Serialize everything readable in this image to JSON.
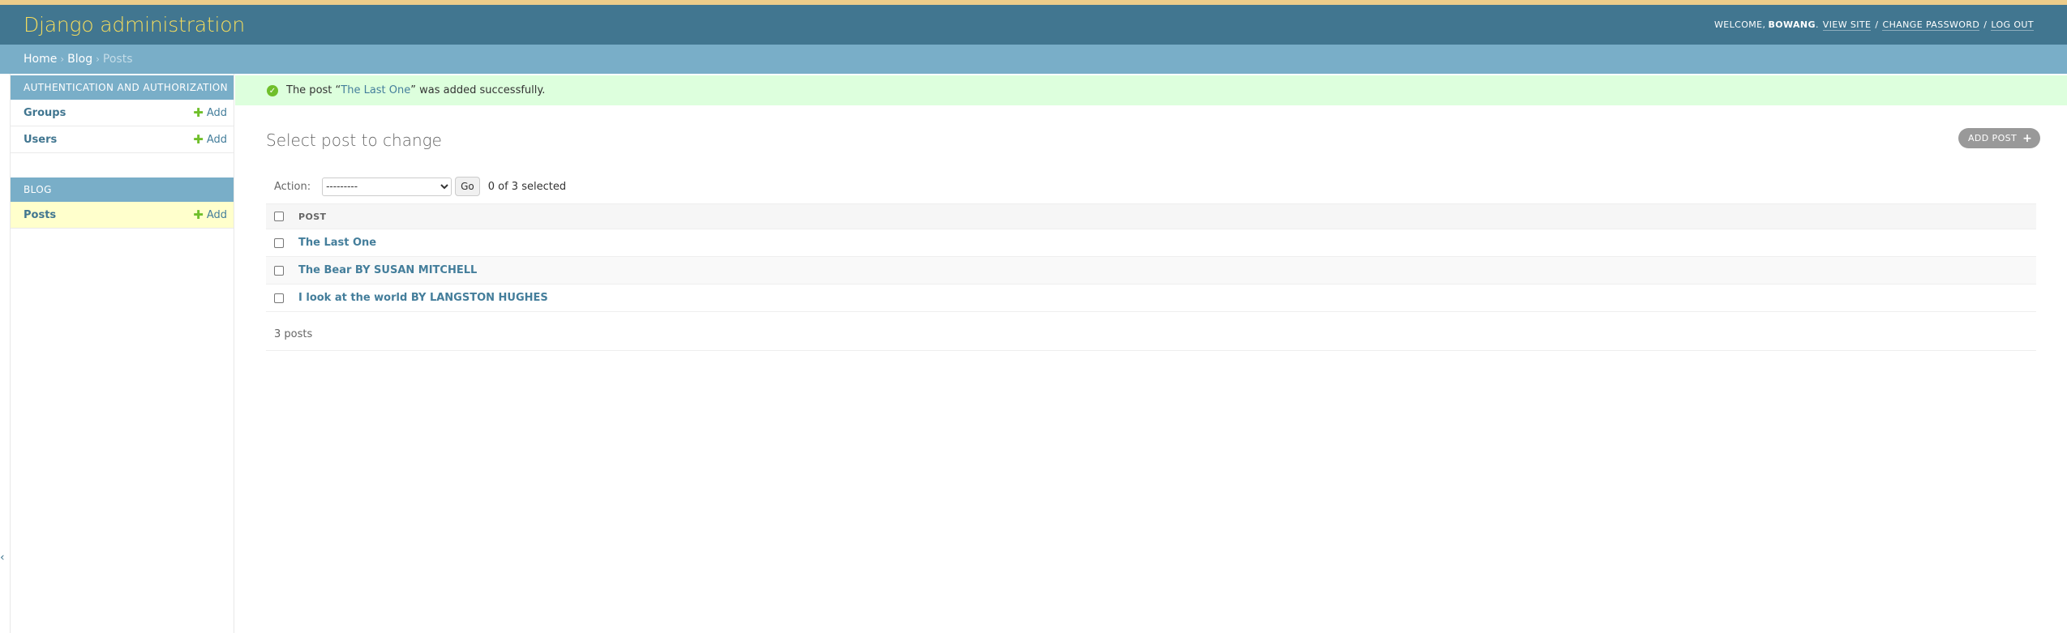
{
  "header": {
    "brand": "Django administration",
    "welcome": "Welcome,",
    "username": "bowang",
    "view_site": "View site",
    "change_password": "Change password",
    "log_out": "Log out",
    "sep": "/"
  },
  "breadcrumbs": {
    "home": "Home",
    "app": "Blog",
    "current": "Posts",
    "sep": "›"
  },
  "sidebar": {
    "modules": [
      {
        "caption": "Authentication and Authorization",
        "models": [
          {
            "name": "Groups",
            "add": "Add"
          },
          {
            "name": "Users",
            "add": "Add"
          }
        ]
      },
      {
        "caption": "Blog",
        "models": [
          {
            "name": "Posts",
            "add": "Add"
          }
        ]
      }
    ],
    "toggle": "‹"
  },
  "message": {
    "prefix": "The post “",
    "link": "The Last One",
    "suffix": "” was added successfully."
  },
  "main": {
    "title": "Select post to change",
    "add_button": "Add post",
    "add_icon": "+",
    "action_label": "Action:",
    "action_select": "---------",
    "go": "Go",
    "selected": "0 of 3 selected",
    "column_header": "Post",
    "rows": [
      "The Last One",
      "The Bear BY SUSAN MITCHELL",
      "I look at the world BY LANGSTON HUGHES"
    ],
    "count": "3 posts"
  },
  "colors": {
    "header": "#417690",
    "breadcrumbs": "#79aec8",
    "brand": "#f5dd5d",
    "success": "#dfd",
    "link": "#447e9b",
    "add": "#70bf2b",
    "current_row": "#ffffcc"
  }
}
